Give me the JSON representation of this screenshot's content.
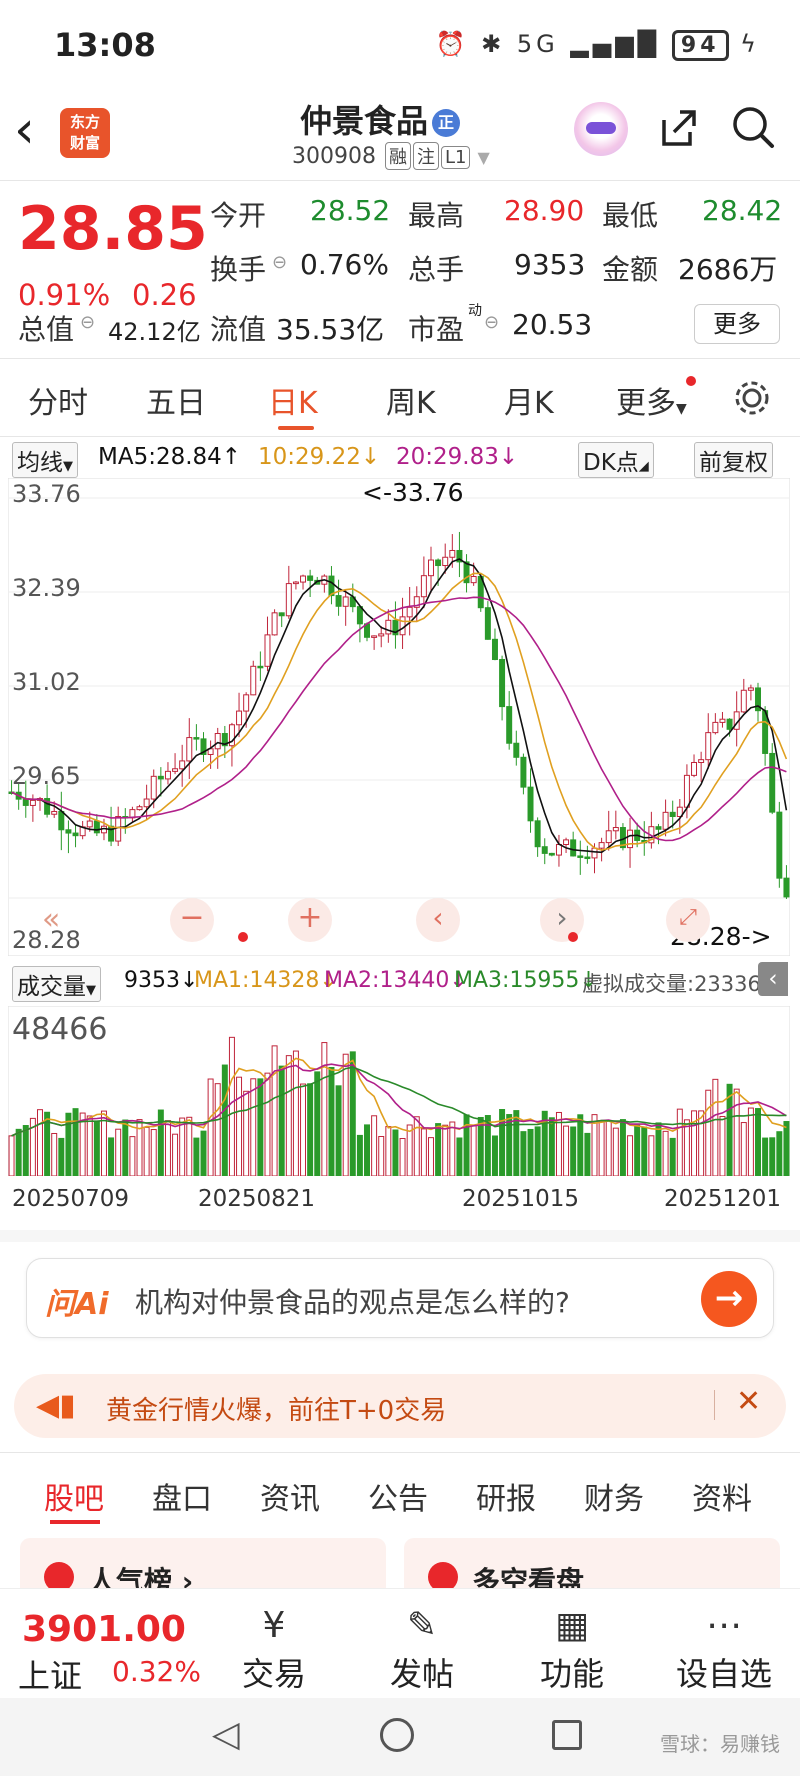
{
  "status": {
    "time": "13:08",
    "signal": "5G",
    "battery": "94"
  },
  "header": {
    "logo_line1": "东方",
    "logo_line2": "财富",
    "name": "仲景食品",
    "badge": "正",
    "code": "300908",
    "tags": [
      "融",
      "注",
      "L1"
    ]
  },
  "quote": {
    "price": "28.85",
    "change_pct": "0.91%",
    "change": "0.26",
    "open_label": "今开",
    "open": "28.52",
    "high_label": "最高",
    "high": "28.90",
    "low_label": "最低",
    "low": "28.42",
    "turnover_label": "换手",
    "turnover": "0.76%",
    "vol_label": "总手",
    "vol": "9353",
    "amount_label": "金额",
    "amount": "2686万",
    "mcap_label": "总值",
    "mcap": "42.12亿",
    "float_label": "流值",
    "float": "35.53亿",
    "pe_label": "市盈",
    "pe_sup": "动",
    "pe": "20.53",
    "more": "更多"
  },
  "tabs": [
    "分时",
    "五日",
    "日K",
    "周K",
    "月K",
    "更多"
  ],
  "ma": {
    "select": "均线",
    "ma5": "MA5:28.84↑",
    "ma10": "10:29.22↓",
    "ma20": "20:29.83↓",
    "dk": "DK点",
    "adj": "前复权"
  },
  "chart_data": {
    "type": "candlestick",
    "y_ticks": [
      "33.76",
      "32.39",
      "31.02",
      "29.65",
      "28.28"
    ],
    "high_marker": "<-33.76",
    "low_marker": "28.28->",
    "x_labels": [
      "20250709",
      "20250821",
      "20251015",
      "20251201"
    ],
    "vol_max": "48466",
    "colors": {
      "up": "#c0243a",
      "down": "#2a9a2a",
      "ma5": "#111111",
      "ma10": "#e0a020",
      "ma20": "#b0208a",
      "vol_ma3": "#2a8a2a"
    }
  },
  "volume": {
    "select": "成交量",
    "vol": "9353↓",
    "ma1": "MA1:14328↓",
    "ma2": "MA2:13440↓",
    "ma3": "MA3:15955↓",
    "virtual": "虚拟成交量:23336"
  },
  "ai": {
    "logo": "问Ai",
    "question": "机构对仲景食品的观点是怎么样的?",
    "go": "→"
  },
  "banner": {
    "text": "黄金行情火爆，前往T+0交易",
    "close": "✕"
  },
  "bottom_tabs": [
    "股吧",
    "盘口",
    "资讯",
    "公告",
    "研报",
    "财务",
    "资料"
  ],
  "cards": {
    "left": "人气榜",
    "right": "多空看盘"
  },
  "nav": {
    "index_value": "3901.00",
    "index_name": "上证",
    "index_pct": "0.32%",
    "items": [
      {
        "icon": "¥",
        "label": "交易"
      },
      {
        "icon": "✎",
        "label": "发帖"
      },
      {
        "icon": "▦",
        "label": "功能"
      },
      {
        "icon": "⋯",
        "label": "设自选"
      }
    ]
  },
  "watermark": "雪球：易赚钱"
}
